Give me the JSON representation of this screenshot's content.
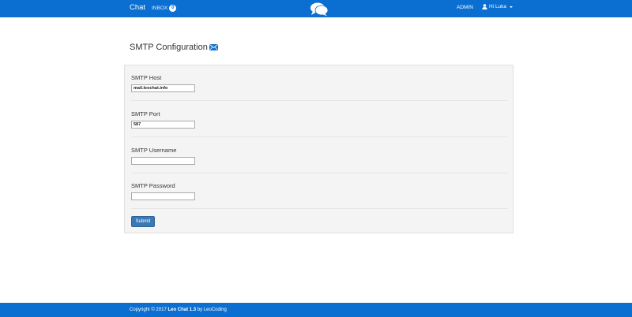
{
  "navbar": {
    "brand": "Chat",
    "inbox_label": "INBOX",
    "inbox_count": "0",
    "logo_icon": "chat-bubbles-icon",
    "admin_label": "ADMIN",
    "user_label": "Hi Luka",
    "user_icon": "user-icon",
    "color": "#0b6fd1"
  },
  "page": {
    "title": "SMTP Configuration",
    "title_icon": "envelope-icon"
  },
  "form": {
    "host_label": "SMTP Host",
    "host_value": "mail.leochat.info",
    "port_label": "SMTP Port",
    "port_value": "587",
    "username_label": "SMTP Username",
    "username_value": "",
    "password_label": "SMTP Password",
    "password_value": "",
    "submit_label": "Submit"
  },
  "footer": {
    "prefix": "Copyright © 2017",
    "product": "Leo Chat 1.3",
    "suffix": "by LeoCoding"
  }
}
